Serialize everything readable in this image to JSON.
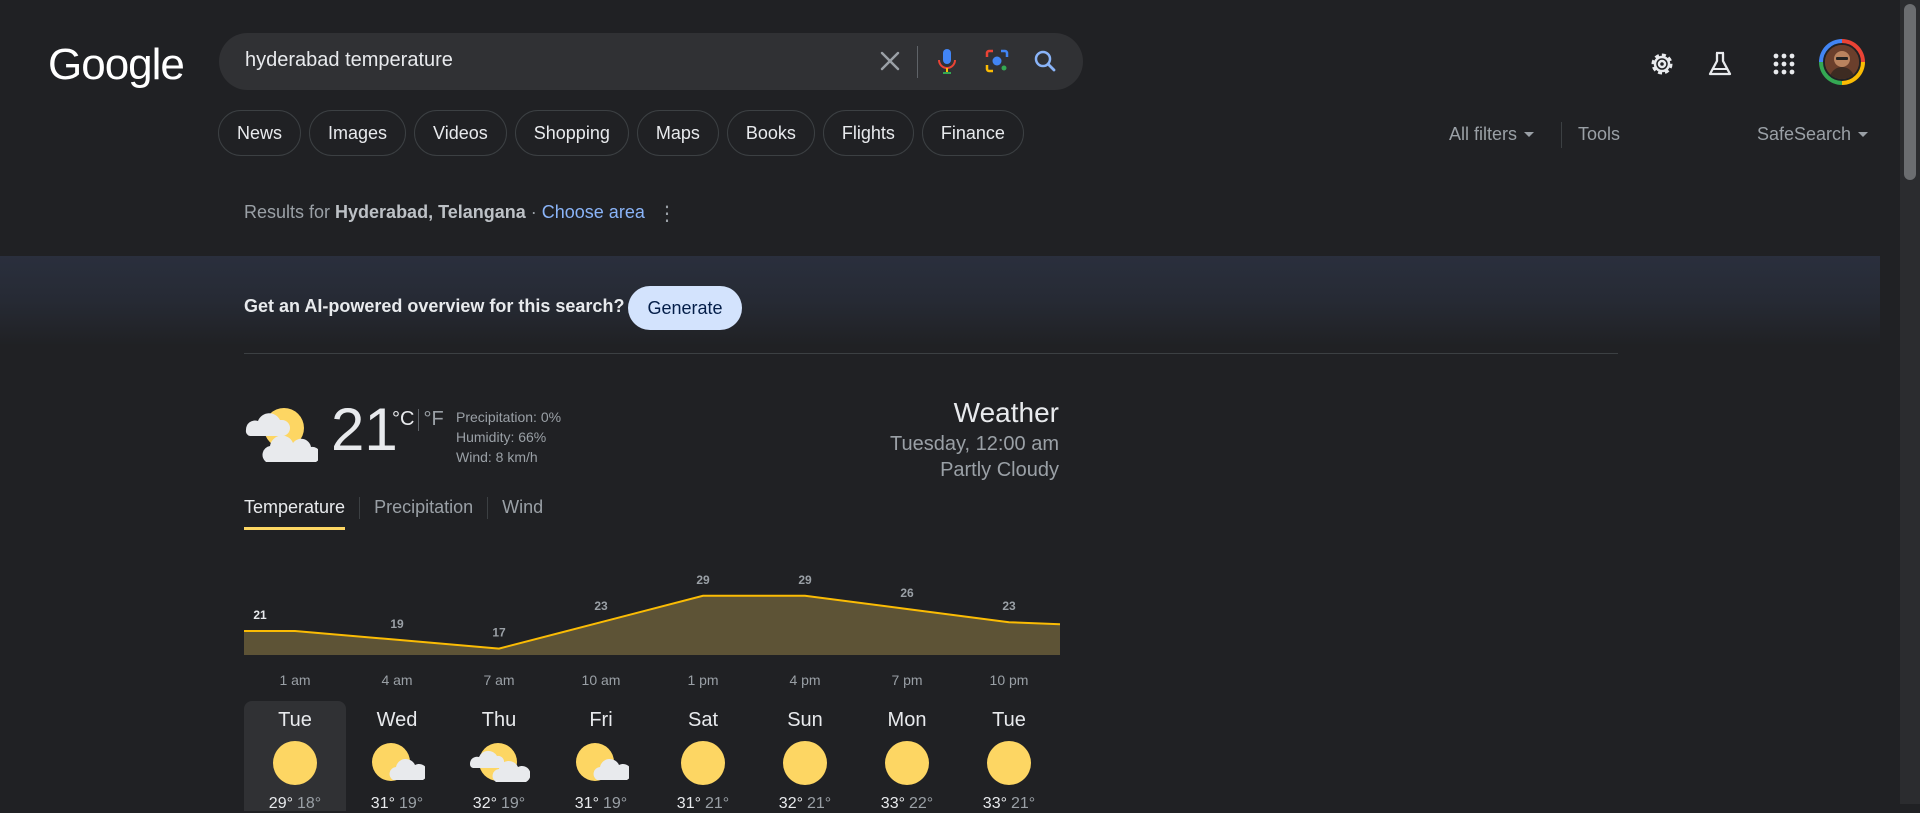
{
  "logo": "Google",
  "search": {
    "query": "hyderabad temperature"
  },
  "chips": [
    "News",
    "Images",
    "Videos",
    "Shopping",
    "Maps",
    "Books",
    "Flights",
    "Finance"
  ],
  "filters": {
    "all_filters": "All filters",
    "tools": "Tools",
    "safesearch": "SafeSearch"
  },
  "results_for": {
    "prefix": "Results for ",
    "location": "Hyderabad, Telangana",
    "separator": " · ",
    "choose_area": "Choose area"
  },
  "ai_overview": {
    "prompt": "Get an AI-powered overview for this search?",
    "button": "Generate"
  },
  "weather": {
    "temperature": "21",
    "unit_c": "°C",
    "unit_f": "°F",
    "precipitation": "Precipitation: 0%",
    "humidity": "Humidity: 66%",
    "wind": "Wind: 8 km/h",
    "title": "Weather",
    "datetime": "Tuesday, 12:00 am",
    "condition": "Partly Cloudy",
    "tabs": [
      "Temperature",
      "Precipitation",
      "Wind"
    ]
  },
  "chart_data": {
    "type": "area",
    "x": [
      "1 am",
      "4 am",
      "7 am",
      "10 am",
      "1 pm",
      "4 pm",
      "7 pm",
      "10 pm"
    ],
    "series": [
      {
        "values": [
          21,
          19,
          17,
          23,
          29,
          29,
          26,
          23
        ]
      }
    ],
    "color": "#fbbc04"
  },
  "forecast": [
    {
      "day": "Tue",
      "icon": "sun-icon",
      "high": "29°",
      "low": "18°"
    },
    {
      "day": "Wed",
      "icon": "partly-cloudy-icon",
      "high": "31°",
      "low": "19°"
    },
    {
      "day": "Thu",
      "icon": "partly-cloudy-icon",
      "high": "32°",
      "low": "19°"
    },
    {
      "day": "Fri",
      "icon": "partly-cloudy-icon",
      "high": "31°",
      "low": "19°"
    },
    {
      "day": "Sat",
      "icon": "sun-icon",
      "high": "31°",
      "low": "21°"
    },
    {
      "day": "Sun",
      "icon": "sun-icon",
      "high": "32°",
      "low": "21°"
    },
    {
      "day": "Mon",
      "icon": "sun-icon",
      "high": "33°",
      "low": "22°"
    },
    {
      "day": "Tue",
      "icon": "sun-icon",
      "high": "33°",
      "low": "21°"
    }
  ],
  "colors": {
    "background": "#202124",
    "accent": "#fdd663",
    "link": "#8ab4f8"
  }
}
